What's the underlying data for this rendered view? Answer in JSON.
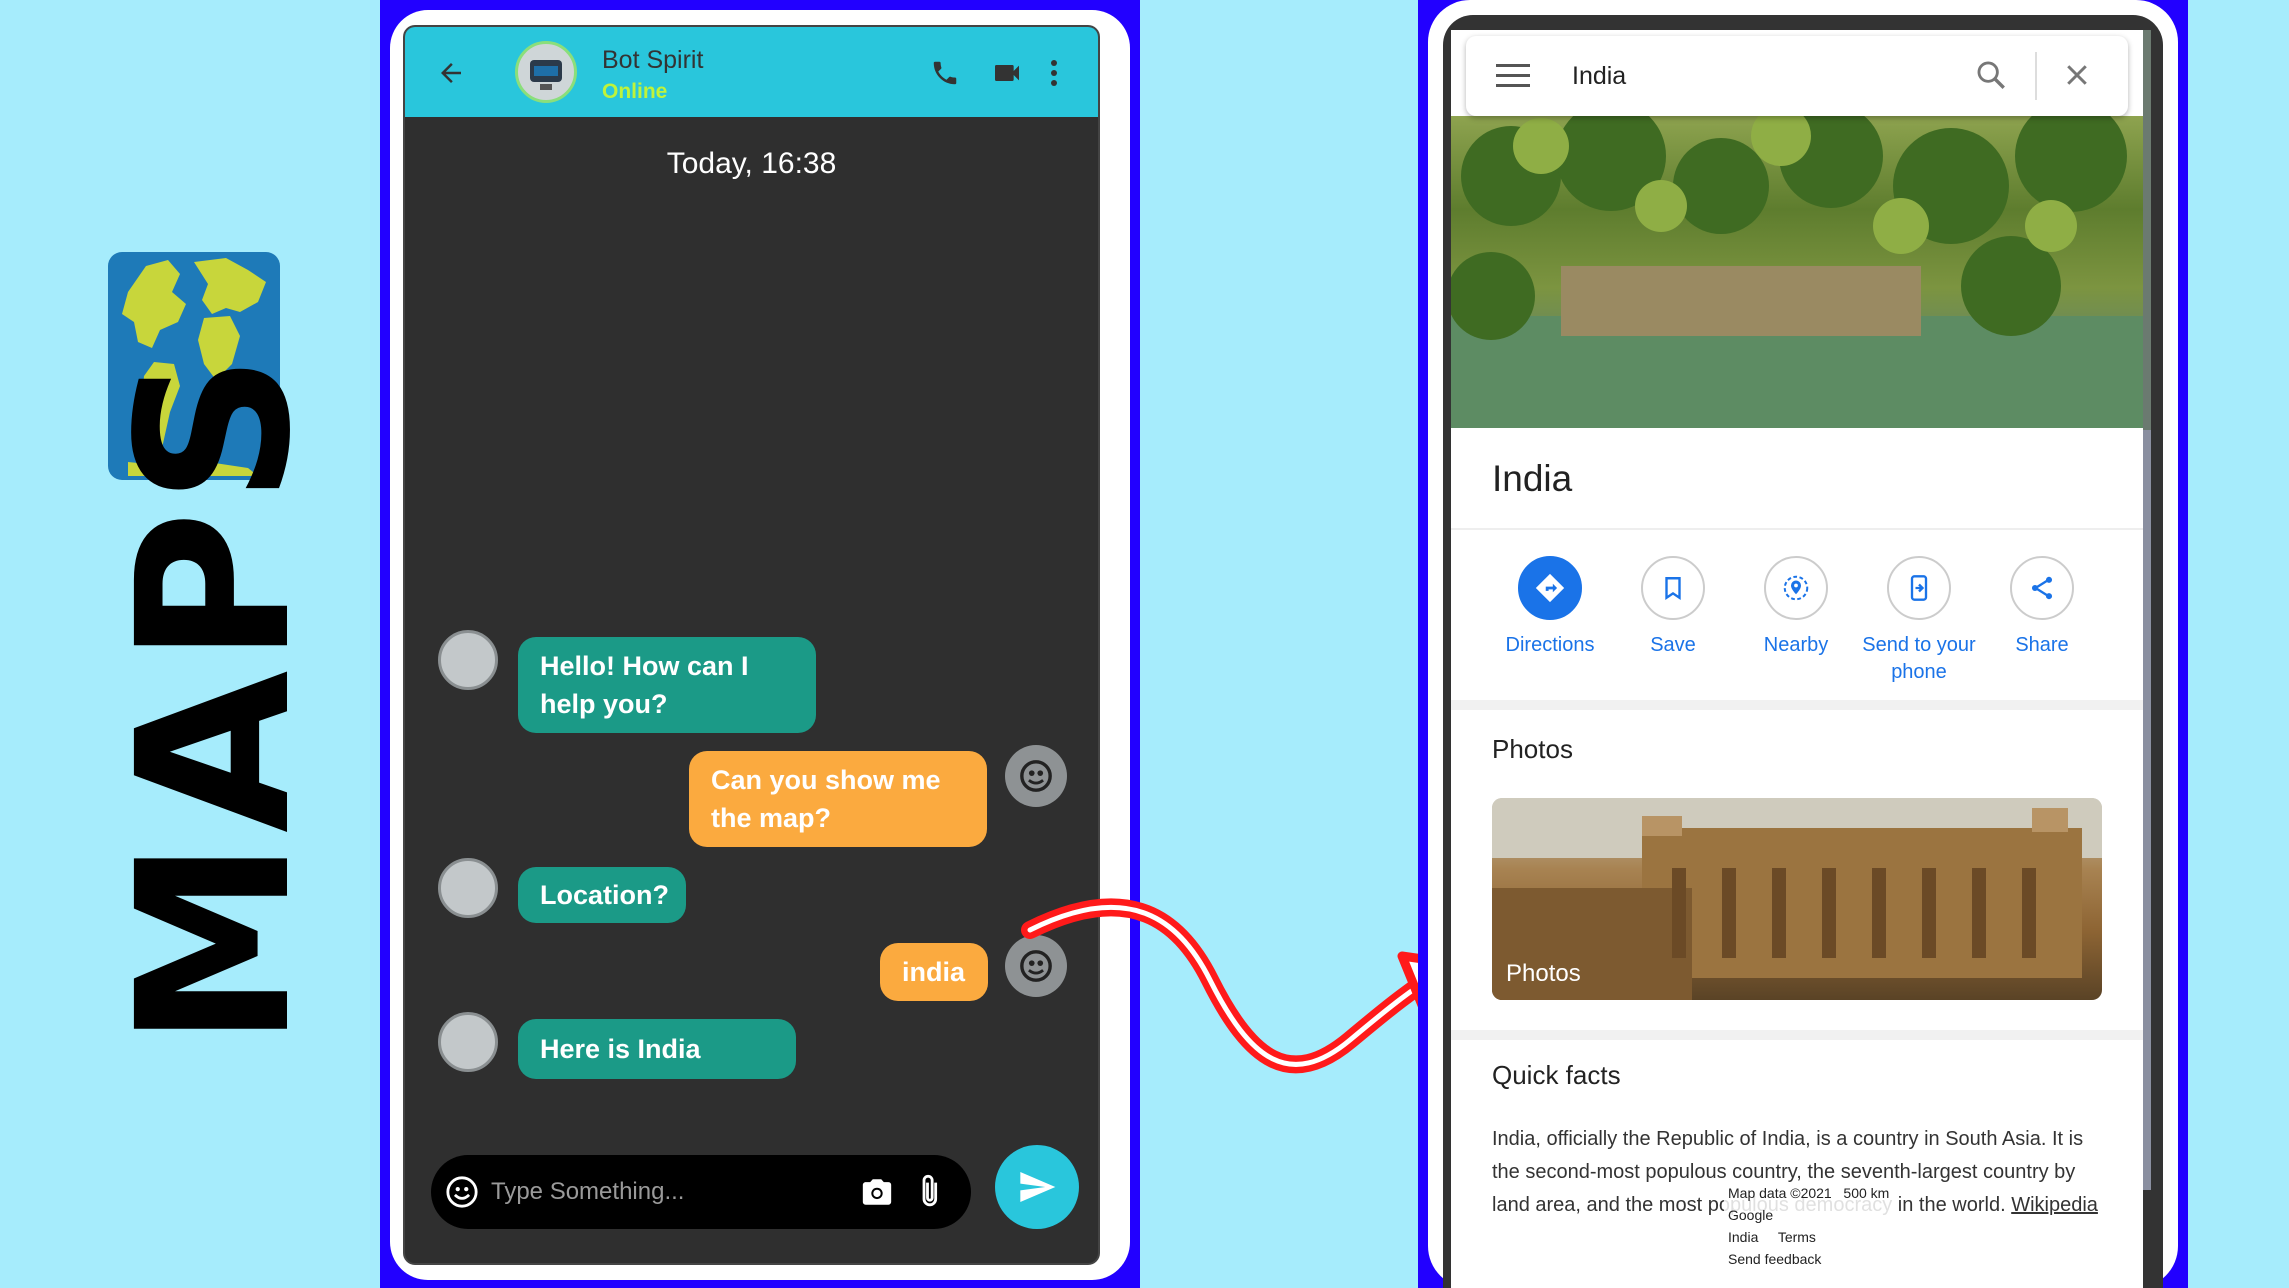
{
  "brand": {
    "text": "MAPS",
    "icon": "world-map-icon"
  },
  "chat": {
    "bot_name": "Bot Spirit",
    "bot_status": "Online",
    "date": "Today, 16:38",
    "messages": [
      {
        "from": "bot",
        "text": "Hello! How can I help you?"
      },
      {
        "from": "user",
        "text": "Can you show me the map?"
      },
      {
        "from": "bot",
        "text": "Location?"
      },
      {
        "from": "user",
        "text": "india"
      },
      {
        "from": "bot",
        "text": "Here is India"
      }
    ],
    "input_placeholder": "Type Something...",
    "colors": {
      "header": "#29c6dc",
      "bot_bubble": "#1b9a87",
      "user_bubble": "#fbaa3f",
      "status": "#bff33a"
    }
  },
  "maps": {
    "search_value": "India",
    "place_title": "India",
    "actions": [
      {
        "label": "Directions",
        "icon": "directions-icon"
      },
      {
        "label": "Save",
        "icon": "bookmark-icon"
      },
      {
        "label": "Nearby",
        "icon": "nearby-icon"
      },
      {
        "label": "Send to your phone",
        "icon": "send-to-phone-icon"
      },
      {
        "label": "Share",
        "icon": "share-icon"
      }
    ],
    "photos_title": "Photos",
    "photo_label": "Photos",
    "quick_facts_title": "Quick facts",
    "facts_text": "India, officially the Republic of India, is a country in South Asia. It is the second-most populous country, the seventh-largest country by land area, and the most populous democracy in the world.",
    "facts_link": "Wikipedia",
    "attribution": {
      "map_data": "Map data ©2021",
      "scale": "500 km",
      "google": "Google",
      "india": "India",
      "terms": "Terms",
      "feedback": "Send feedback"
    },
    "accent": "#1a73e8"
  }
}
